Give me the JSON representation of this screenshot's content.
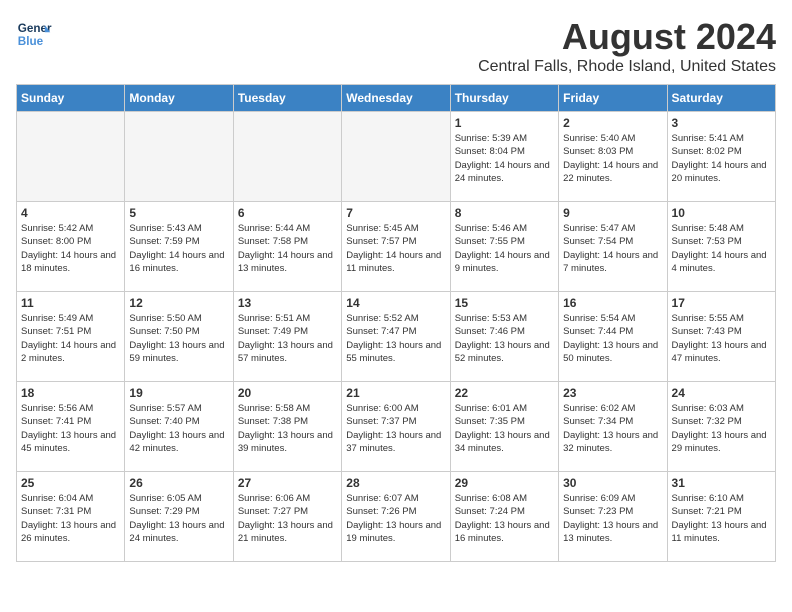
{
  "logo": {
    "line1": "General",
    "line2": "Blue"
  },
  "title": "August 2024",
  "subtitle": "Central Falls, Rhode Island, United States",
  "days_of_week": [
    "Sunday",
    "Monday",
    "Tuesday",
    "Wednesday",
    "Thursday",
    "Friday",
    "Saturday"
  ],
  "weeks": [
    [
      {
        "day": "",
        "empty": true
      },
      {
        "day": "",
        "empty": true
      },
      {
        "day": "",
        "empty": true
      },
      {
        "day": "",
        "empty": true
      },
      {
        "day": "1",
        "line1": "Sunrise: 5:39 AM",
        "line2": "Sunset: 8:04 PM",
        "line3": "Daylight: 14 hours and 24 minutes."
      },
      {
        "day": "2",
        "line1": "Sunrise: 5:40 AM",
        "line2": "Sunset: 8:03 PM",
        "line3": "Daylight: 14 hours and 22 minutes."
      },
      {
        "day": "3",
        "line1": "Sunrise: 5:41 AM",
        "line2": "Sunset: 8:02 PM",
        "line3": "Daylight: 14 hours and 20 minutes."
      }
    ],
    [
      {
        "day": "4",
        "line1": "Sunrise: 5:42 AM",
        "line2": "Sunset: 8:00 PM",
        "line3": "Daylight: 14 hours and 18 minutes."
      },
      {
        "day": "5",
        "line1": "Sunrise: 5:43 AM",
        "line2": "Sunset: 7:59 PM",
        "line3": "Daylight: 14 hours and 16 minutes."
      },
      {
        "day": "6",
        "line1": "Sunrise: 5:44 AM",
        "line2": "Sunset: 7:58 PM",
        "line3": "Daylight: 14 hours and 13 minutes."
      },
      {
        "day": "7",
        "line1": "Sunrise: 5:45 AM",
        "line2": "Sunset: 7:57 PM",
        "line3": "Daylight: 14 hours and 11 minutes."
      },
      {
        "day": "8",
        "line1": "Sunrise: 5:46 AM",
        "line2": "Sunset: 7:55 PM",
        "line3": "Daylight: 14 hours and 9 minutes."
      },
      {
        "day": "9",
        "line1": "Sunrise: 5:47 AM",
        "line2": "Sunset: 7:54 PM",
        "line3": "Daylight: 14 hours and 7 minutes."
      },
      {
        "day": "10",
        "line1": "Sunrise: 5:48 AM",
        "line2": "Sunset: 7:53 PM",
        "line3": "Daylight: 14 hours and 4 minutes."
      }
    ],
    [
      {
        "day": "11",
        "line1": "Sunrise: 5:49 AM",
        "line2": "Sunset: 7:51 PM",
        "line3": "Daylight: 14 hours and 2 minutes."
      },
      {
        "day": "12",
        "line1": "Sunrise: 5:50 AM",
        "line2": "Sunset: 7:50 PM",
        "line3": "Daylight: 13 hours and 59 minutes."
      },
      {
        "day": "13",
        "line1": "Sunrise: 5:51 AM",
        "line2": "Sunset: 7:49 PM",
        "line3": "Daylight: 13 hours and 57 minutes."
      },
      {
        "day": "14",
        "line1": "Sunrise: 5:52 AM",
        "line2": "Sunset: 7:47 PM",
        "line3": "Daylight: 13 hours and 55 minutes."
      },
      {
        "day": "15",
        "line1": "Sunrise: 5:53 AM",
        "line2": "Sunset: 7:46 PM",
        "line3": "Daylight: 13 hours and 52 minutes."
      },
      {
        "day": "16",
        "line1": "Sunrise: 5:54 AM",
        "line2": "Sunset: 7:44 PM",
        "line3": "Daylight: 13 hours and 50 minutes."
      },
      {
        "day": "17",
        "line1": "Sunrise: 5:55 AM",
        "line2": "Sunset: 7:43 PM",
        "line3": "Daylight: 13 hours and 47 minutes."
      }
    ],
    [
      {
        "day": "18",
        "line1": "Sunrise: 5:56 AM",
        "line2": "Sunset: 7:41 PM",
        "line3": "Daylight: 13 hours and 45 minutes."
      },
      {
        "day": "19",
        "line1": "Sunrise: 5:57 AM",
        "line2": "Sunset: 7:40 PM",
        "line3": "Daylight: 13 hours and 42 minutes."
      },
      {
        "day": "20",
        "line1": "Sunrise: 5:58 AM",
        "line2": "Sunset: 7:38 PM",
        "line3": "Daylight: 13 hours and 39 minutes."
      },
      {
        "day": "21",
        "line1": "Sunrise: 6:00 AM",
        "line2": "Sunset: 7:37 PM",
        "line3": "Daylight: 13 hours and 37 minutes."
      },
      {
        "day": "22",
        "line1": "Sunrise: 6:01 AM",
        "line2": "Sunset: 7:35 PM",
        "line3": "Daylight: 13 hours and 34 minutes."
      },
      {
        "day": "23",
        "line1": "Sunrise: 6:02 AM",
        "line2": "Sunset: 7:34 PM",
        "line3": "Daylight: 13 hours and 32 minutes."
      },
      {
        "day": "24",
        "line1": "Sunrise: 6:03 AM",
        "line2": "Sunset: 7:32 PM",
        "line3": "Daylight: 13 hours and 29 minutes."
      }
    ],
    [
      {
        "day": "25",
        "line1": "Sunrise: 6:04 AM",
        "line2": "Sunset: 7:31 PM",
        "line3": "Daylight: 13 hours and 26 minutes."
      },
      {
        "day": "26",
        "line1": "Sunrise: 6:05 AM",
        "line2": "Sunset: 7:29 PM",
        "line3": "Daylight: 13 hours and 24 minutes."
      },
      {
        "day": "27",
        "line1": "Sunrise: 6:06 AM",
        "line2": "Sunset: 7:27 PM",
        "line3": "Daylight: 13 hours and 21 minutes."
      },
      {
        "day": "28",
        "line1": "Sunrise: 6:07 AM",
        "line2": "Sunset: 7:26 PM",
        "line3": "Daylight: 13 hours and 19 minutes."
      },
      {
        "day": "29",
        "line1": "Sunrise: 6:08 AM",
        "line2": "Sunset: 7:24 PM",
        "line3": "Daylight: 13 hours and 16 minutes."
      },
      {
        "day": "30",
        "line1": "Sunrise: 6:09 AM",
        "line2": "Sunset: 7:23 PM",
        "line3": "Daylight: 13 hours and 13 minutes."
      },
      {
        "day": "31",
        "line1": "Sunrise: 6:10 AM",
        "line2": "Sunset: 7:21 PM",
        "line3": "Daylight: 13 hours and 11 minutes."
      }
    ]
  ]
}
